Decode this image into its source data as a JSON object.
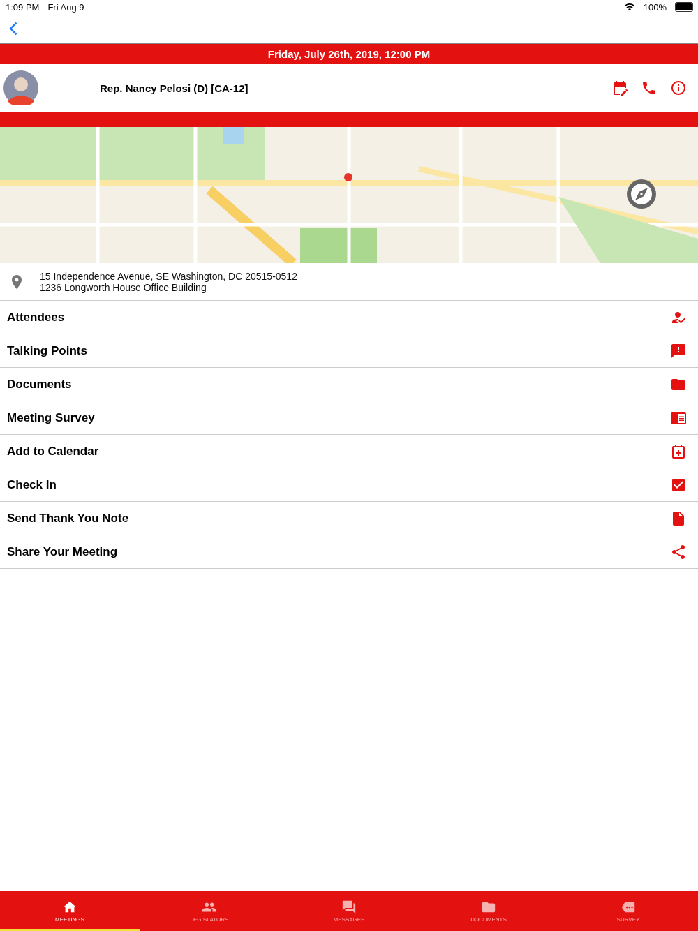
{
  "status_bar": {
    "time": "1:09 PM",
    "date": "Fri Aug 9",
    "battery": "100%"
  },
  "meeting": {
    "datetime": "Friday, July 26th, 2019, 12:00 PM",
    "legislator": "Rep. Nancy Pelosi (D) [CA-12]"
  },
  "address": {
    "line_1": "15 Independence Avenue, SE Washington, DC 20515-0512",
    "line_2": "1236 Longworth House Office Building"
  },
  "menu": [
    {
      "label": "Attendees"
    },
    {
      "label": "Talking Points"
    },
    {
      "label": "Documents"
    },
    {
      "label": "Meeting Survey"
    },
    {
      "label": "Add to Calendar"
    },
    {
      "label": "Check In"
    },
    {
      "label": "Send Thank You Note"
    },
    {
      "label": "Share Your Meeting"
    }
  ],
  "tabs": [
    {
      "label": "MEETINGS",
      "selected": true
    },
    {
      "label": "LEGISLATORS",
      "selected": false
    },
    {
      "label": "MESSAGES",
      "selected": false
    },
    {
      "label": "DOCUMENTS",
      "selected": false
    },
    {
      "label": "SURVEY",
      "selected": false
    }
  ]
}
